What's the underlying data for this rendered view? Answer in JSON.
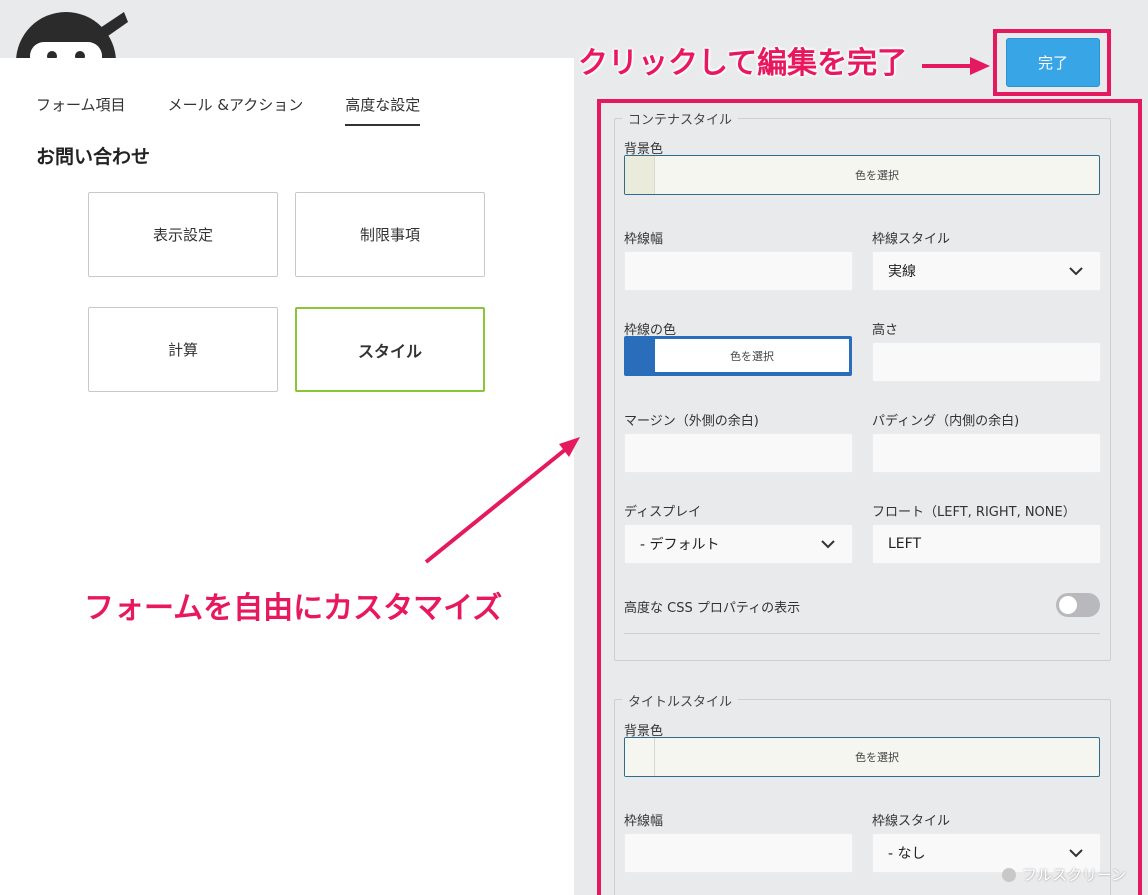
{
  "tabs": [
    {
      "label": "フォーム項目",
      "active": false
    },
    {
      "label": "メール &アクション",
      "active": false
    },
    {
      "label": "高度な設定",
      "active": true
    }
  ],
  "form_title": "お問い合わせ",
  "cards": [
    {
      "label": "表示設定",
      "selected": false
    },
    {
      "label": "制限事項",
      "selected": false
    },
    {
      "label": "計算",
      "selected": false
    },
    {
      "label": "スタイル",
      "selected": true
    }
  ],
  "done_button": "完了",
  "container_style": {
    "legend": "コンテナスタイル",
    "bg_color_label": "背景色",
    "bg_color_button": "色を選択",
    "bg_swatch_color": "#ebebdc",
    "border_width_label": "枠線幅",
    "border_width_value": "",
    "border_style_label": "枠線スタイル",
    "border_style_value": "実線",
    "border_color_label": "枠線の色",
    "border_color_button": "色を選択",
    "border_swatch_color": "#2a6ebb",
    "height_label": "高さ",
    "height_value": "",
    "margin_label": "マージン（外側の余白)",
    "margin_value": "",
    "padding_label": "パディング（内側の余白)",
    "padding_value": "",
    "display_label": "ディスプレイ",
    "display_value": "- デフォルト",
    "float_label": "フロート（LEFT, RIGHT, NONE）",
    "float_value": "LEFT",
    "advanced_css_label": "高度な CSS プロパティの表示",
    "advanced_css_enabled": false
  },
  "title_style": {
    "legend": "タイトルスタイル",
    "bg_color_label": "背景色",
    "bg_color_button": "色を選択",
    "border_width_label": "枠線幅",
    "border_style_label": "枠線スタイル",
    "border_style_value": "- なし"
  },
  "fullscreen_label": "フルスクリーン",
  "annotations": {
    "done_callout": "クリックして編集を完了",
    "customize_callout": "フォームを自由にカスタマイズ"
  },
  "colors": {
    "accent_red": "#e5195d",
    "done_blue": "#38a5e6",
    "selected_green": "#89c43b"
  }
}
